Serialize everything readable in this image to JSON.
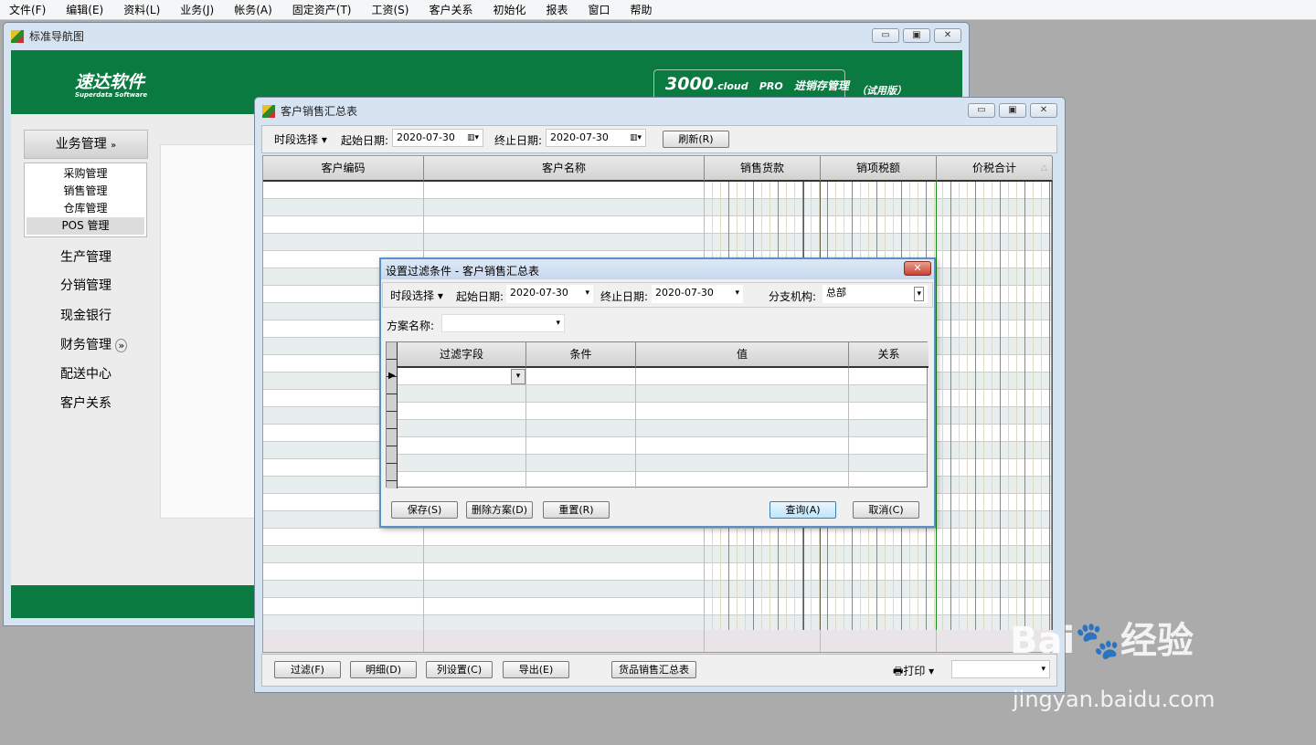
{
  "menubar": [
    "文件(F)",
    "编辑(E)",
    "资料(L)",
    "业务(J)",
    "帐务(A)",
    "固定资产(T)",
    "工资(S)",
    "客户关系",
    "初始化",
    "报表",
    "窗口",
    "帮助"
  ],
  "nav_window": {
    "title": "标准导航图",
    "brand": {
      "name": "速达软件",
      "sub": "Superdata Software"
    },
    "product": {
      "ver": "3000",
      "cloud": ".cloud",
      "pro": "PRO",
      "name": "进销存管理",
      "trial": "（试用版）"
    },
    "group": "业务管理",
    "sub_items": [
      "采购管理",
      "销售管理",
      "仓库管理",
      "POS 管理"
    ],
    "items": [
      "生产管理",
      "分销管理",
      "现金银行",
      "财务管理",
      "配送中心",
      "客户关系"
    ]
  },
  "report_window": {
    "title": "客户销售汇总表",
    "period_label": "时段选择",
    "start_label": "起始日期:",
    "start_value": "2020-07-30",
    "end_label": "终止日期:",
    "end_value": "2020-07-30",
    "refresh": "刷新(R)",
    "columns": [
      "客户编码",
      "客户名称",
      "销售货款",
      "销项税额",
      "价税合计"
    ],
    "bottom_buttons": [
      "过滤(F)",
      "明细(D)",
      "列设置(C)",
      "导出(E)",
      "货品销售汇总表"
    ],
    "print": "打印"
  },
  "filter_dialog": {
    "title": "设置过滤条件 - 客户销售汇总表",
    "period_label": "时段选择",
    "start_label": "起始日期:",
    "start_value": "2020-07-30",
    "end_label": "终止日期:",
    "end_value": "2020-07-30",
    "branch_label": "分支机构:",
    "branch_value": "总部",
    "scheme_label": "方案名称:",
    "scheme_value": "",
    "columns": [
      "过滤字段",
      "条件",
      "值",
      "关系"
    ],
    "buttons": {
      "save": "保存(S)",
      "delete": "删除方案(D)",
      "reset": "重置(R)",
      "query": "查询(A)",
      "cancel": "取消(C)"
    }
  },
  "watermark": {
    "logo": "Baidu经验",
    "url": "jingyan.baidu.com"
  },
  "colors": {
    "green": "#0a7a40",
    "background": "#ababab"
  }
}
